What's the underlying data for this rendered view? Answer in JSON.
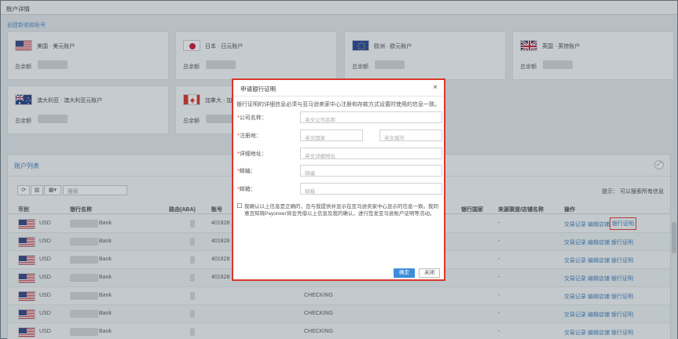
{
  "window": {
    "title": "账户详情"
  },
  "create_link": "创建新收款账号",
  "cards": [
    {
      "name": "美国 · 美元账户",
      "flag": "us-flag-icon",
      "balance_label": "总余额"
    },
    {
      "name": "日本 · 日元账户",
      "flag": "jp-flag-icon",
      "balance_label": "总余额"
    },
    {
      "name": "欧洲 · 欧元账户",
      "flag": "eu-flag-icon",
      "balance_label": "总余额"
    },
    {
      "name": "英国 · 英镑账户",
      "flag": "uk-flag-icon",
      "balance_label": "总余额"
    },
    {
      "name": "澳大利亚 · 澳大利亚元账户",
      "flag": "au-flag-icon",
      "balance_label": "总余额"
    },
    {
      "name": "加拿大 · 加",
      "flag": "ca-flag-icon",
      "balance_label": "总余额"
    }
  ],
  "list": {
    "title": "账户列表",
    "search_placeholder": "搜索",
    "hint": "提示： 可以搜索所有信息",
    "columns": [
      "币别",
      "银行名称",
      "路由(ABA)",
      "账号",
      "银行国家",
      "来源渠道/店铺名称",
      "操作"
    ],
    "rows": [
      {
        "currency": "USD",
        "bank": "Bank",
        "account": "401828",
        "type": "",
        "channel": "-",
        "a1": "交易记录",
        "a2": "编辑店铺",
        "a3": "银行证明"
      },
      {
        "currency": "USD",
        "bank": "Bank",
        "account": "401828",
        "type": "",
        "channel": "-",
        "a1": "交易记录",
        "a2": "编辑店铺",
        "a3": "银行证明"
      },
      {
        "currency": "USD",
        "bank": "Bank",
        "account": "401828",
        "type": "",
        "channel": "-",
        "a1": "交易记录",
        "a2": "编辑店铺",
        "a3": "银行证明"
      },
      {
        "currency": "USD",
        "bank": "Bank",
        "account": "401828",
        "type": "",
        "channel": "-",
        "a1": "交易记录",
        "a2": "编辑店铺",
        "a3": "银行证明"
      },
      {
        "currency": "USD",
        "bank": "Bank",
        "account": "",
        "type": "CHECKING",
        "channel": "-",
        "a1": "交易记录",
        "a2": "编辑店铺",
        "a3": "银行证明"
      },
      {
        "currency": "USD",
        "bank": "Bank",
        "account": "",
        "type": "CHECKING",
        "channel": "-",
        "a1": "交易记录",
        "a2": "编辑店铺",
        "a3": "银行证明"
      },
      {
        "currency": "USD",
        "bank": "Bank",
        "account": "",
        "type": "CHECKING",
        "channel": "-",
        "a1": "交易记录",
        "a2": "编辑店铺",
        "a3": "银行证明"
      }
    ]
  },
  "modal": {
    "title": "申请银行证明",
    "description": "银行证明的详细信息必须与亚马逊卖家中心注册和存款方式设置时使用的信息一致。",
    "fields": {
      "company_label": "公司名称：",
      "company_placeholder": "英文公司名称",
      "reg_label": "注册地：",
      "country_placeholder": "英文国家",
      "city_placeholder": "英文城市",
      "address_label": "详细地址：",
      "address_placeholder": "英文详细地址",
      "zip_label": "邮编：",
      "zip_placeholder": "邮编",
      "email_label": "邮箱：",
      "email_placeholder": "邮箱"
    },
    "agreement": "我确认以上信息是正确的，且与我提供并显示在亚马逊卖家中心显示的信息一致。我同意且知晓Payoneer将会凭借以上信息及我的确认，进行签发亚马逊账户证明等活动。",
    "confirm": "确定",
    "cancel": "关闭",
    "required_mark": "*"
  },
  "colors": {
    "accent": "#3d8ed8",
    "highlight": "#d9372b",
    "link": "#3a78b7"
  }
}
